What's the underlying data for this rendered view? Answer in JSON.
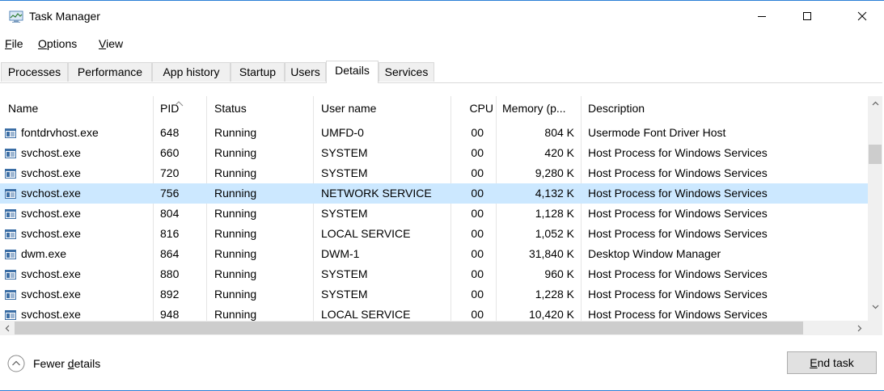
{
  "window": {
    "title": "Task Manager",
    "accent_color": "#2b7fd6",
    "controls": [
      "minimize-icon",
      "maximize-icon",
      "close-icon"
    ]
  },
  "menu": {
    "items": [
      {
        "label": "File",
        "underline_first": "F",
        "rest": "ile"
      },
      {
        "label": "Options",
        "underline_first": "O",
        "rest": "ptions"
      },
      {
        "label": "View",
        "underline_first": "V",
        "rest": "iew"
      }
    ]
  },
  "tabs": [
    {
      "label": "Processes",
      "active": false
    },
    {
      "label": "Performance",
      "active": false
    },
    {
      "label": "App history",
      "active": false
    },
    {
      "label": "Startup",
      "active": false
    },
    {
      "label": "Users",
      "active": false
    },
    {
      "label": "Details",
      "active": true
    },
    {
      "label": "Services",
      "active": false
    }
  ],
  "table": {
    "columns": [
      {
        "key": "name",
        "label": "Name"
      },
      {
        "key": "pid",
        "label": "PID",
        "sorted": "ascending"
      },
      {
        "key": "status",
        "label": "Status"
      },
      {
        "key": "user",
        "label": "User name"
      },
      {
        "key": "cpu",
        "label": "CPU"
      },
      {
        "key": "memory",
        "label": "Memory (p..."
      },
      {
        "key": "description",
        "label": "Description"
      }
    ],
    "selected_index": 3,
    "selected_color": "#cce8ff",
    "rows": [
      {
        "name": "fontdrvhost.exe",
        "pid": "648",
        "status": "Running",
        "user": "UMFD-0",
        "cpu": "00",
        "memory": "804 K",
        "description": "Usermode Font Driver Host"
      },
      {
        "name": "svchost.exe",
        "pid": "660",
        "status": "Running",
        "user": "SYSTEM",
        "cpu": "00",
        "memory": "420 K",
        "description": "Host Process for Windows Services"
      },
      {
        "name": "svchost.exe",
        "pid": "720",
        "status": "Running",
        "user": "SYSTEM",
        "cpu": "00",
        "memory": "9,280 K",
        "description": "Host Process for Windows Services"
      },
      {
        "name": "svchost.exe",
        "pid": "756",
        "status": "Running",
        "user": "NETWORK SERVICE",
        "cpu": "00",
        "memory": "4,132 K",
        "description": "Host Process for Windows Services"
      },
      {
        "name": "svchost.exe",
        "pid": "804",
        "status": "Running",
        "user": "SYSTEM",
        "cpu": "00",
        "memory": "1,128 K",
        "description": "Host Process for Windows Services"
      },
      {
        "name": "svchost.exe",
        "pid": "816",
        "status": "Running",
        "user": "LOCAL SERVICE",
        "cpu": "00",
        "memory": "1,052 K",
        "description": "Host Process for Windows Services"
      },
      {
        "name": "dwm.exe",
        "pid": "864",
        "status": "Running",
        "user": "DWM-1",
        "cpu": "00",
        "memory": "31,840 K",
        "description": "Desktop Window Manager"
      },
      {
        "name": "svchost.exe",
        "pid": "880",
        "status": "Running",
        "user": "SYSTEM",
        "cpu": "00",
        "memory": "960 K",
        "description": "Host Process for Windows Services"
      },
      {
        "name": "svchost.exe",
        "pid": "892",
        "status": "Running",
        "user": "SYSTEM",
        "cpu": "00",
        "memory": "1,228 K",
        "description": "Host Process for Windows Services"
      },
      {
        "name": "svchost.exe",
        "pid": "948",
        "status": "Running",
        "user": "LOCAL SERVICE",
        "cpu": "00",
        "memory": "10,420 K",
        "description": "Host Process for Windows Services"
      }
    ]
  },
  "footer": {
    "fewer_details": {
      "before": "Fewer ",
      "underline": "d",
      "after": "etails",
      "label": "Fewer details"
    },
    "end_task": {
      "underline": "E",
      "rest": "nd task",
      "label": "End task"
    }
  }
}
